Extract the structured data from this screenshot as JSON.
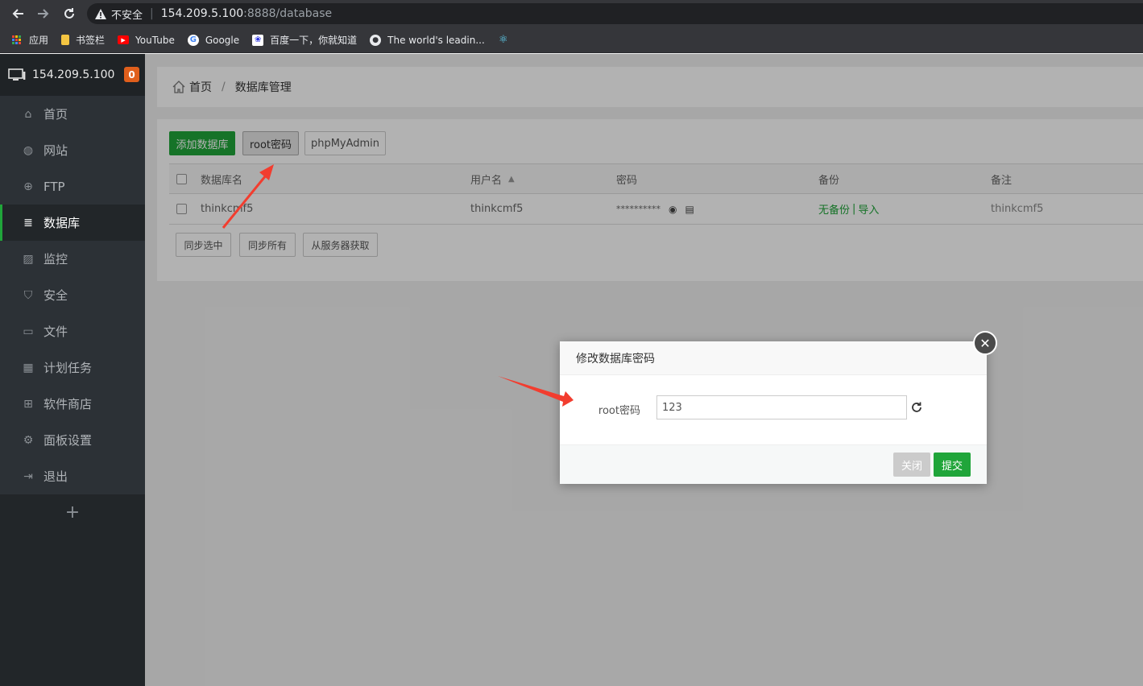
{
  "browser": {
    "security_label": "不安全",
    "url_host": "154.209.5.100",
    "url_rest": ":8888/database",
    "bookmarks": [
      {
        "label": "应用",
        "icon": "apps-icon"
      },
      {
        "label": "书签栏",
        "icon": "folder-icon"
      },
      {
        "label": "YouTube",
        "icon": "youtube-icon"
      },
      {
        "label": "Google",
        "icon": "google-icon"
      },
      {
        "label": "百度一下，你就知道",
        "icon": "baidu-icon"
      },
      {
        "label": "The world's leadin...",
        "icon": "github-icon"
      },
      {
        "label": "",
        "icon": "react-icon"
      }
    ]
  },
  "sidebar": {
    "server_ip": "154.209.5.100",
    "badge_count": "0",
    "items": [
      {
        "label": "首页",
        "icon": "home-icon"
      },
      {
        "label": "网站",
        "icon": "globe-icon"
      },
      {
        "label": "FTP",
        "icon": "ftp-icon"
      },
      {
        "label": "数据库",
        "icon": "database-icon",
        "active": true
      },
      {
        "label": "监控",
        "icon": "monitor-chart-icon"
      },
      {
        "label": "安全",
        "icon": "shield-icon"
      },
      {
        "label": "文件",
        "icon": "folder-icon"
      },
      {
        "label": "计划任务",
        "icon": "calendar-icon"
      },
      {
        "label": "软件商店",
        "icon": "grid-icon"
      },
      {
        "label": "面板设置",
        "icon": "gear-icon"
      },
      {
        "label": "退出",
        "icon": "logout-icon"
      }
    ],
    "add_label": "+"
  },
  "breadcrumb": {
    "home": "首页",
    "sep": "/",
    "current": "数据库管理"
  },
  "toolbar": {
    "add_db": "添加数据库",
    "root_password": "root密码",
    "phpmyadmin": "phpMyAdmin"
  },
  "table": {
    "headers": {
      "name": "数据库名",
      "user": "用户名",
      "password": "密码",
      "backup": "备份",
      "note": "备注"
    },
    "rows": [
      {
        "name": "thinkcmf5",
        "user": "thinkcmf5",
        "password": "**********",
        "backup_none": "无备份",
        "backup_sep": "|",
        "import": "导入",
        "note": "thinkcmf5"
      }
    ]
  },
  "bottom_actions": {
    "sync_selected": "同步选中",
    "sync_all": "同步所有",
    "fetch_server": "从服务器获取"
  },
  "dialog": {
    "title": "修改数据库密码",
    "label": "root密码",
    "value": "123",
    "close": "关闭",
    "submit": "提交",
    "close_x": "✕"
  },
  "colors": {
    "green": "#20a53a",
    "sidebar": "#2c3136",
    "badge": "#e05f1c",
    "arrow": "#f23d2f"
  }
}
